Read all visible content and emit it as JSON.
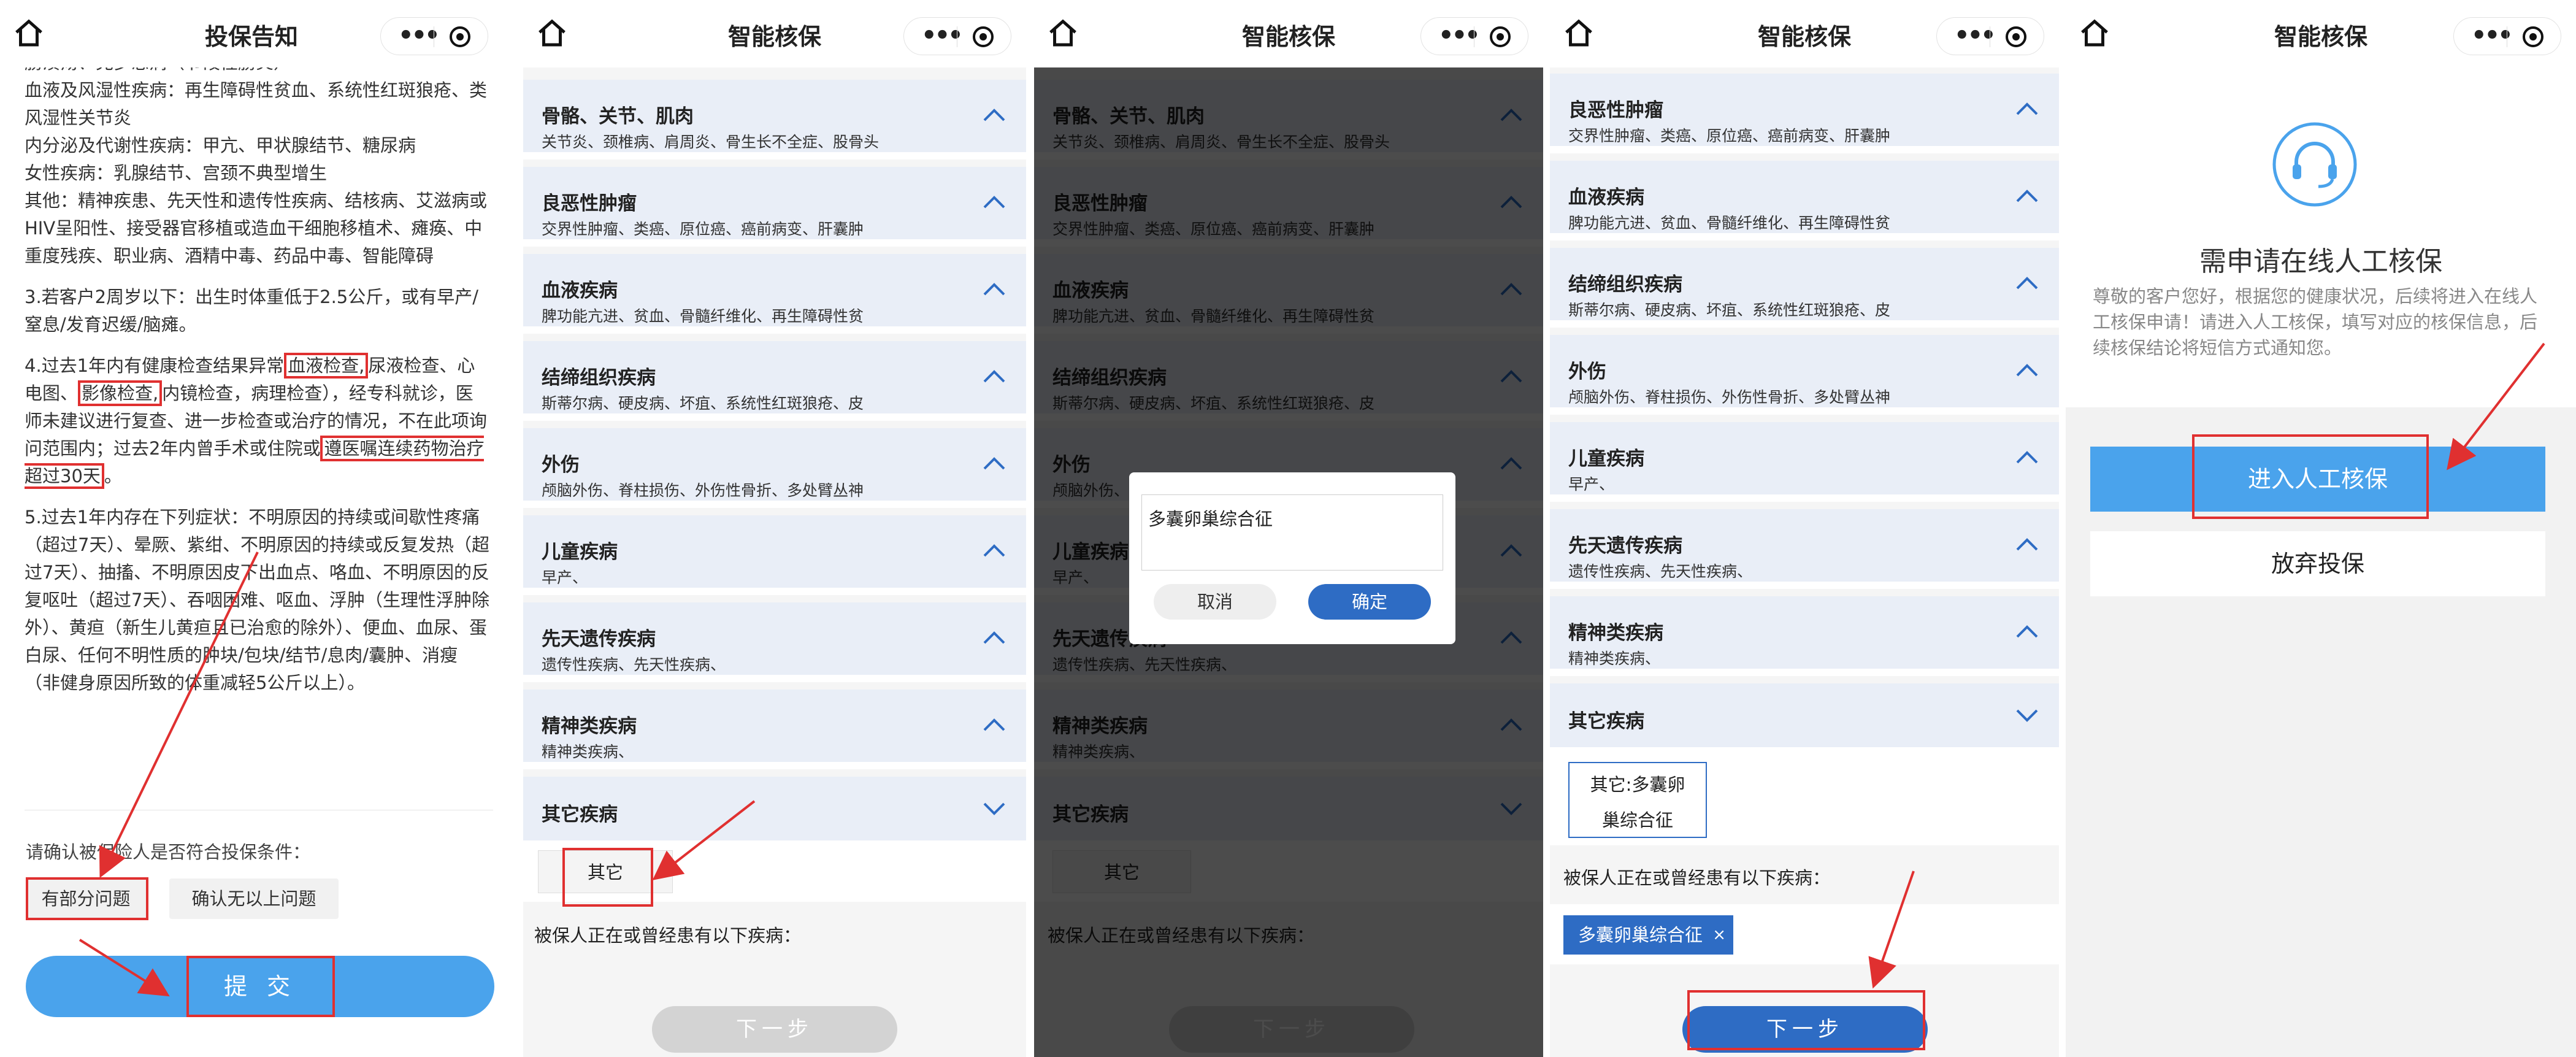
{
  "panel1": {
    "title": "投保告知",
    "notice_paragraphs": [
      "肠溃疡、克罗恩病（节段性肠炎）",
      "血液及风湿性疾病：再生障碍性贫血、系统性红斑狼疮、类风湿性关节炎",
      "内分泌及代谢性疾病：甲亢、甲状腺结节、糖尿病",
      "女性疾病：乳腺结节、宫颈不典型增生",
      "其他：精神疾患、先天性和遗传性疾病、结核病、艾滋病或HIV呈阳性、接受器官移植或造血干细胞移植术、瘫痪、中重度残疾、职业病、酒精中毒、药品中毒、智能障碍"
    ],
    "item3": "3.若客户2周岁以下：出生时体重低于2.5公斤，或有早产/窒息/发育迟缓/脑瘫。",
    "item4_parts": [
      "4.过去1年内有健康检查结果异常",
      "血液检查,",
      "尿液检查、心电图、",
      "影像检查,",
      "内镜检查，病理检查），经专科就诊，医师未建议进行复查、进一步检查或治疗的情况，不在此项询问范围内；过去2年内曾手术或住院或",
      "遵医嘱连续药物治疗超过30天",
      "。"
    ],
    "item5": "5.过去1年内存在下列症状：不明原因的持续或间歇性疼痛（超过7天）、晕厥、紫绀、不明原因的持续或反复发热（超过7天）、抽搐、不明原因皮下出血点、咯血、不明原因的反复呕吐（超过7天）、吞咽困难、呕血、浮肿（生理性浮肿除外）、黄疸（新生儿黄疸且已治愈的除外）、便血、血尿、蛋白尿、任何不明性质的肿块/包块/结节/息肉/囊肿、消瘦（非健身原因所致的体重减轻5公斤以上）。",
    "confirm_question": "请确认被保险人是否符合投保条件：",
    "option_partial": "有部分问题",
    "option_none": "确认无以上问题",
    "submit_label": "提 交"
  },
  "smart_title": "智能核保",
  "categories": {
    "bone": {
      "name": "骨骼、关节、肌肉",
      "sub": "关节炎、颈椎病、肩周炎、骨生长不全症、股骨头"
    },
    "benign": {
      "name": "良恶性肿瘤",
      "sub": "交界性肿瘤、类癌、原位癌、癌前病变、肝囊肿"
    },
    "blood": {
      "name": "血液疾病",
      "sub": "脾功能亢进、贫血、骨髓纤维化、再生障碍性贫"
    },
    "connective": {
      "name": "结缔组织疾病",
      "sub": "斯蒂尔病、硬皮病、坏疽、系统性红斑狼疮、皮"
    },
    "trauma": {
      "name": "外伤",
      "sub": "颅脑外伤、脊柱损伤、外伤性骨折、多处臂丛神"
    },
    "child": {
      "name": "儿童疾病",
      "sub": "早产、"
    },
    "congenital": {
      "name": "先天遗传疾病",
      "sub": "遗传性疾病、先天性疾病、"
    },
    "mental": {
      "name": "精神类疾病",
      "sub": "精神类疾病、"
    },
    "other": {
      "name": "其它疾病"
    }
  },
  "other_tag": "其它",
  "other_tag_filled": "其它:多囊卵巢综合征",
  "question_current": "被保人正在或曾经患有以下疾病：",
  "next_label": "下一步",
  "dialog": {
    "input_value": "多囊卵巢综合征",
    "cancel": "取消",
    "ok": "确定"
  },
  "selected_chip": "多囊卵巢综合征",
  "chip_remove": "×",
  "panel5": {
    "title": "智能核保",
    "heading": "需申请在线人工核保",
    "desc": "尊敬的客户您好，根据您的健康状况，后续将进入在线人工核保申请！请进入人工核保，填写对应的核保信息，后续核保结论将短信方式通知您。",
    "enter_label": "进入人工核保",
    "giveup_label": "放弃投保"
  },
  "colors": {
    "primary": "#4aa3ec",
    "dark_blue": "#2e6cc4",
    "highlight_red": "#e03030",
    "category_bg": "#e9eef7"
  }
}
